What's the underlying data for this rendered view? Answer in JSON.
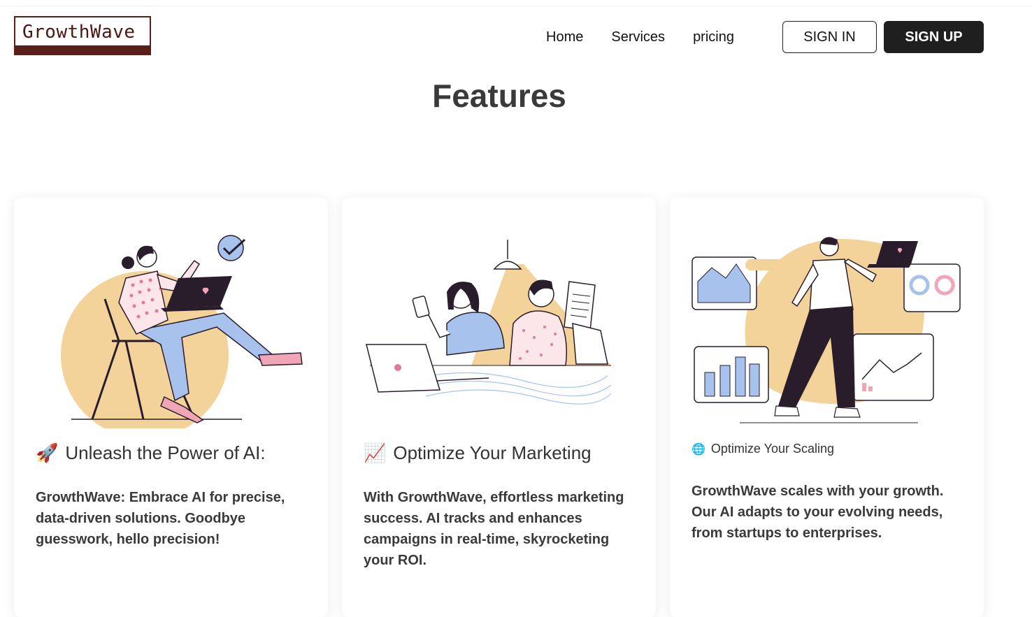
{
  "brand": {
    "name": "GrowthWave"
  },
  "nav": {
    "items": [
      "Home",
      "Services",
      "pricing"
    ]
  },
  "auth": {
    "sign_in": "SIGN IN",
    "sign_up": "SIGN UP"
  },
  "page": {
    "heading": "Features"
  },
  "cards": [
    {
      "icon": "rocket-icon",
      "title": "Unleash the Power of AI:",
      "body": "GrowthWave: Embrace AI for precise, data-driven solutions. Goodbye guesswork, hello precision!"
    },
    {
      "icon": "chart-increasing-icon",
      "title": "Optimize Your Marketing",
      "body": "With GrowthWave, effortless marketing success. AI tracks and enhances campaigns in real-time, skyrocketing your ROI."
    },
    {
      "icon": "globe-icon",
      "title": "Optimize Your Scaling",
      "body": "GrowthWave scales with your growth. Our AI adapts to your evolving needs, from startups to enterprises."
    }
  ],
  "colors": {
    "accent_beige": "#f4d39b",
    "accent_blue": "#a8c2ee",
    "dark": "#2a1d2b",
    "brand_maroon": "#5b1f1a"
  }
}
